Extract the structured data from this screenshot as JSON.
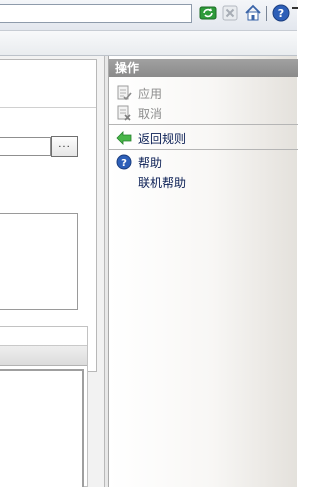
{
  "actions_pane": {
    "title": "操作",
    "items": [
      {
        "label": "应用",
        "enabled": false,
        "icon": "apply-icon"
      },
      {
        "label": "取消",
        "enabled": false,
        "icon": "cancel-icon"
      },
      {
        "label": "返回规则",
        "enabled": true,
        "icon": "back-arrow-icon"
      },
      {
        "label": "帮助",
        "enabled": true,
        "icon": "help-icon"
      },
      {
        "label": "联机帮助",
        "enabled": true,
        "icon": ""
      }
    ]
  },
  "form": {
    "browse_label": "..."
  },
  "colors": {
    "header_gray": "#939393",
    "link_navy": "#0b1f55",
    "disabled_gray": "#8d8d8d",
    "arrow_green": "#3aa83a",
    "help_blue": "#2d5fb8"
  }
}
